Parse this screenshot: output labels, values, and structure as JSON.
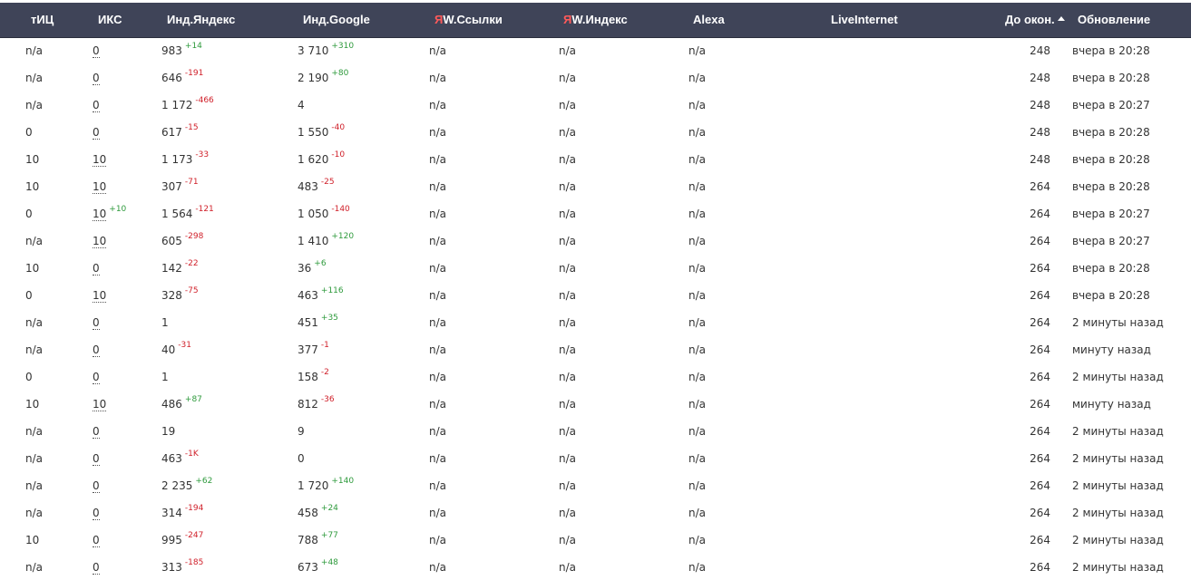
{
  "header": {
    "tic": "тИЦ",
    "iks": "ИКС",
    "ind_yandex": "Инд.Яндекс",
    "ind_google": "Инд.Google",
    "yw_links_prefix": "Я",
    "yw_links_rest": "W.Ссылки",
    "yw_index_prefix": "Я",
    "yw_index_rest": "W.Индекс",
    "alexa": "Alexa",
    "liveinternet": "LiveInternet",
    "days": "До окон.",
    "updated": "Обновление",
    "sort_icon": "sort-asc-icon"
  },
  "rows": [
    {
      "tic": "n/a",
      "iks": "0",
      "iks_d": "",
      "yan": "983",
      "yan_d": "+14",
      "goo": "3 710",
      "goo_d": "+310",
      "yws": "n/a",
      "ywi": "n/a",
      "alx": "n/a",
      "days": "248",
      "upd": "вчера в 20:28"
    },
    {
      "tic": "n/a",
      "iks": "0",
      "iks_d": "",
      "yan": "646",
      "yan_d": "-191",
      "goo": "2 190",
      "goo_d": "+80",
      "yws": "n/a",
      "ywi": "n/a",
      "alx": "n/a",
      "days": "248",
      "upd": "вчера в 20:28"
    },
    {
      "tic": "n/a",
      "iks": "0",
      "iks_d": "",
      "yan": "1 172",
      "yan_d": "-466",
      "goo": "4",
      "goo_d": "",
      "yws": "n/a",
      "ywi": "n/a",
      "alx": "n/a",
      "days": "248",
      "upd": "вчера в 20:27"
    },
    {
      "tic": "0",
      "iks": "0",
      "iks_d": "",
      "yan": "617",
      "yan_d": "-15",
      "goo": "1 550",
      "goo_d": "-40",
      "yws": "n/a",
      "ywi": "n/a",
      "alx": "n/a",
      "days": "248",
      "upd": "вчера в 20:28"
    },
    {
      "tic": "10",
      "iks": "10",
      "iks_d": "",
      "yan": "1 173",
      "yan_d": "-33",
      "goo": "1 620",
      "goo_d": "-10",
      "yws": "n/a",
      "ywi": "n/a",
      "alx": "n/a",
      "days": "248",
      "upd": "вчера в 20:28"
    },
    {
      "tic": "10",
      "iks": "10",
      "iks_d": "",
      "yan": "307",
      "yan_d": "-71",
      "goo": "483",
      "goo_d": "-25",
      "yws": "n/a",
      "ywi": "n/a",
      "alx": "n/a",
      "days": "264",
      "upd": "вчера в 20:28"
    },
    {
      "tic": "0",
      "iks": "10",
      "iks_d": "+10",
      "yan": "1 564",
      "yan_d": "-121",
      "goo": "1 050",
      "goo_d": "-140",
      "yws": "n/a",
      "ywi": "n/a",
      "alx": "n/a",
      "days": "264",
      "upd": "вчера в 20:27"
    },
    {
      "tic": "n/a",
      "iks": "10",
      "iks_d": "",
      "yan": "605",
      "yan_d": "-298",
      "goo": "1 410",
      "goo_d": "+120",
      "yws": "n/a",
      "ywi": "n/a",
      "alx": "n/a",
      "days": "264",
      "upd": "вчера в 20:27"
    },
    {
      "tic": "10",
      "iks": "0",
      "iks_d": "",
      "yan": "142",
      "yan_d": "-22",
      "goo": "36",
      "goo_d": "+6",
      "yws": "n/a",
      "ywi": "n/a",
      "alx": "n/a",
      "days": "264",
      "upd": "вчера в 20:28"
    },
    {
      "tic": "0",
      "iks": "10",
      "iks_d": "",
      "yan": "328",
      "yan_d": "-75",
      "goo": "463",
      "goo_d": "+116",
      "yws": "n/a",
      "ywi": "n/a",
      "alx": "n/a",
      "days": "264",
      "upd": "вчера в 20:28"
    },
    {
      "tic": "n/a",
      "iks": "0",
      "iks_d": "",
      "yan": "1",
      "yan_d": "",
      "goo": "451",
      "goo_d": "+35",
      "yws": "n/a",
      "ywi": "n/a",
      "alx": "n/a",
      "days": "264",
      "upd": "2 минуты назад"
    },
    {
      "tic": "n/a",
      "iks": "0",
      "iks_d": "",
      "yan": "40",
      "yan_d": "-31",
      "goo": "377",
      "goo_d": "-1",
      "yws": "n/a",
      "ywi": "n/a",
      "alx": "n/a",
      "days": "264",
      "upd": "минуту назад"
    },
    {
      "tic": "0",
      "iks": "0",
      "iks_d": "",
      "yan": "1",
      "yan_d": "",
      "goo": "158",
      "goo_d": "-2",
      "yws": "n/a",
      "ywi": "n/a",
      "alx": "n/a",
      "days": "264",
      "upd": "2 минуты назад"
    },
    {
      "tic": "10",
      "iks": "10",
      "iks_d": "",
      "yan": "486",
      "yan_d": "+87",
      "goo": "812",
      "goo_d": "-36",
      "yws": "n/a",
      "ywi": "n/a",
      "alx": "n/a",
      "days": "264",
      "upd": "минуту назад"
    },
    {
      "tic": "n/a",
      "iks": "0",
      "iks_d": "",
      "yan": "19",
      "yan_d": "",
      "goo": "9",
      "goo_d": "",
      "yws": "n/a",
      "ywi": "n/a",
      "alx": "n/a",
      "days": "264",
      "upd": "2 минуты назад"
    },
    {
      "tic": "n/a",
      "iks": "0",
      "iks_d": "",
      "yan": "463",
      "yan_d": "-1K",
      "goo": "0",
      "goo_d": "",
      "yws": "n/a",
      "ywi": "n/a",
      "alx": "n/a",
      "days": "264",
      "upd": "2 минуты назад"
    },
    {
      "tic": "n/a",
      "iks": "0",
      "iks_d": "",
      "yan": "2 235",
      "yan_d": "+62",
      "goo": "1 720",
      "goo_d": "+140",
      "yws": "n/a",
      "ywi": "n/a",
      "alx": "n/a",
      "days": "264",
      "upd": "2 минуты назад"
    },
    {
      "tic": "n/a",
      "iks": "0",
      "iks_d": "",
      "yan": "314",
      "yan_d": "-194",
      "goo": "458",
      "goo_d": "+24",
      "yws": "n/a",
      "ywi": "n/a",
      "alx": "n/a",
      "days": "264",
      "upd": "2 минуты назад"
    },
    {
      "tic": "10",
      "iks": "0",
      "iks_d": "",
      "yan": "995",
      "yan_d": "-247",
      "goo": "788",
      "goo_d": "+77",
      "yws": "n/a",
      "ywi": "n/a",
      "alx": "n/a",
      "days": "264",
      "upd": "2 минуты назад"
    },
    {
      "tic": "n/a",
      "iks": "0",
      "iks_d": "",
      "yan": "313",
      "yan_d": "-185",
      "goo": "673",
      "goo_d": "+48",
      "yws": "n/a",
      "ywi": "n/a",
      "alx": "n/a",
      "days": "264",
      "upd": "2 минуты назад"
    }
  ],
  "colors": {
    "header_bg": "#3f4458",
    "delta_up": "#2e9a3c",
    "delta_down": "#d0202a",
    "ya_brand": "#ff5a5a"
  }
}
